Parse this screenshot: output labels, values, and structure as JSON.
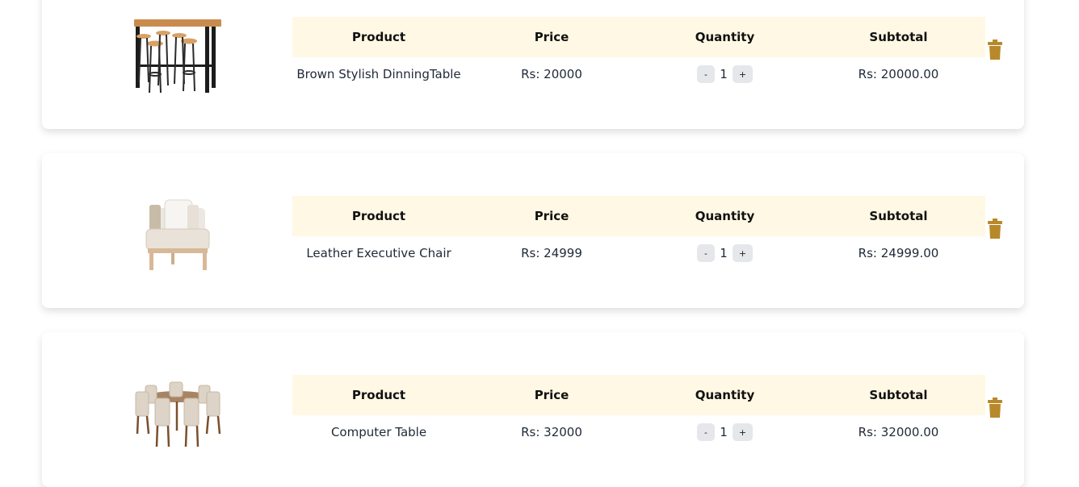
{
  "colors": {
    "header_bg": "#fff8e4",
    "trash": "#b8892a",
    "qty_button_bg": "#e5e7eb"
  },
  "table_headers": {
    "product": "Product",
    "price": "Price",
    "quantity": "Quantity",
    "subtotal": "Subtotal"
  },
  "quantity_controls": {
    "decrement": "-",
    "increment": "+"
  },
  "cart_items": [
    {
      "image_icon": "bar-table-stools-image",
      "product": "Brown Stylish DinningTable",
      "price": "Rs: 20000",
      "quantity": "1",
      "subtotal": "Rs: 20000.00"
    },
    {
      "image_icon": "cushioned-chair-image",
      "product": "Leather Executive Chair",
      "price": "Rs: 24999",
      "quantity": "1",
      "subtotal": "Rs: 24999.00"
    },
    {
      "image_icon": "dining-set-image",
      "product": "Computer Table",
      "price": "Rs: 32000",
      "quantity": "1",
      "subtotal": "Rs: 32000.00"
    }
  ]
}
